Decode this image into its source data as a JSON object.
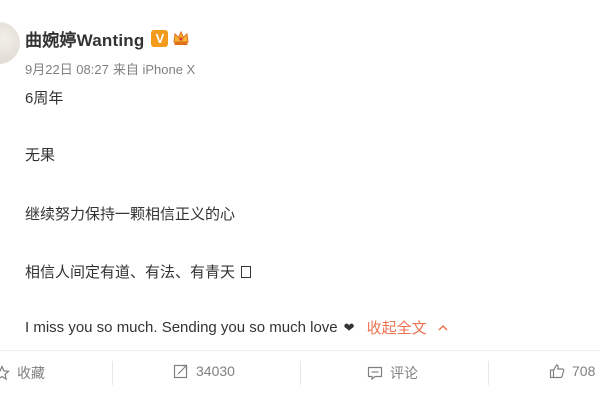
{
  "post": {
    "author": "曲婉婷Wanting",
    "verified_badge": "V",
    "crown_icon": "crown-icon",
    "date": "9月22日 08:27",
    "source": "来自 iPhone X",
    "lines": [
      "6周年",
      "无果",
      "继续努力保持一颗相信正义的心",
      "相信人间定有道、有法、有青天",
      "I miss you so much. Sending you so much love"
    ],
    "heart_icon": "heart-icon",
    "collapse_label": "收起全文"
  },
  "toolbar": {
    "favorite_label": "收藏",
    "repost_count": "34030",
    "comment_label": "评论",
    "like_count": "708"
  },
  "colors": {
    "accent": "#eb7350",
    "vbadge": "#f29b1c",
    "meta": "#808080"
  }
}
